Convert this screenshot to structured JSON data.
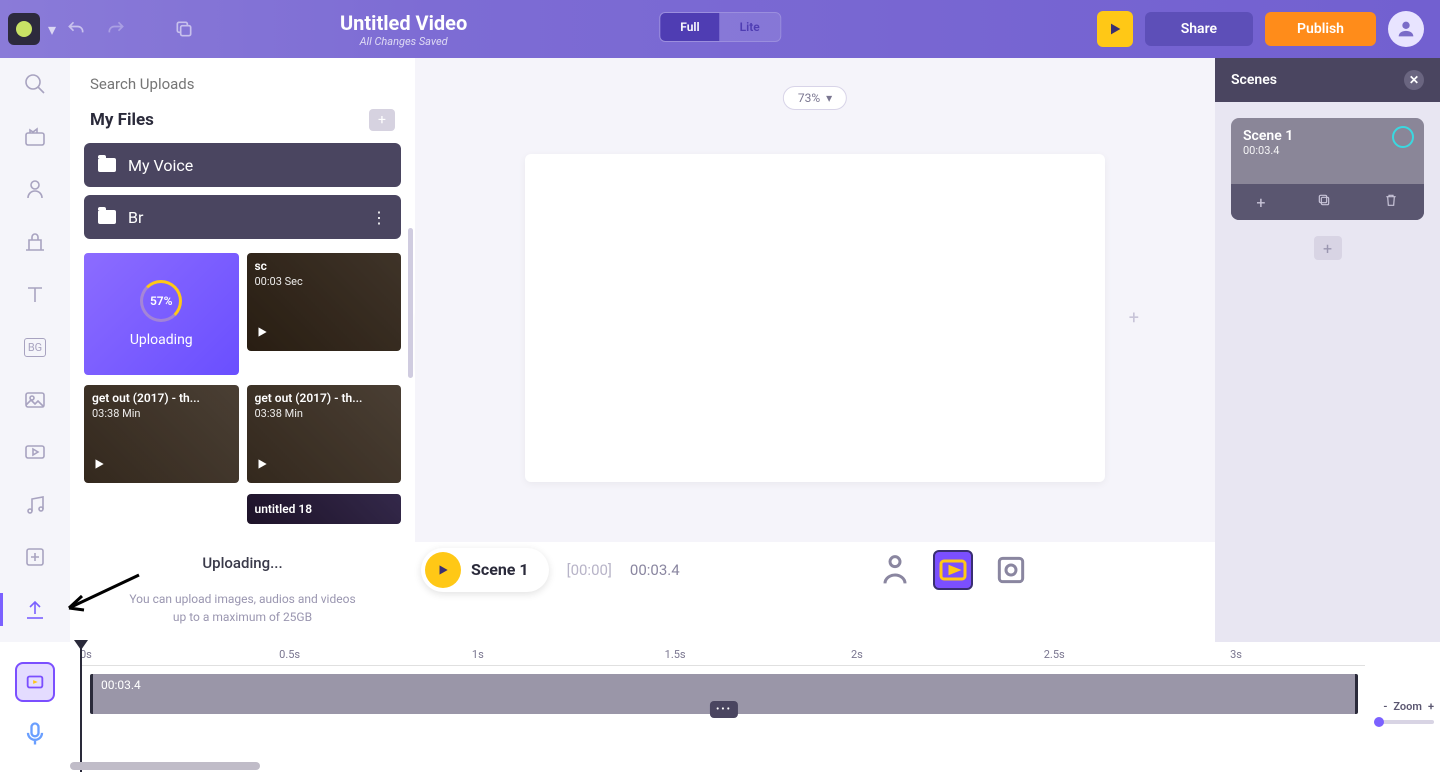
{
  "header": {
    "title": "Untitled Video",
    "save_status": "All Changes Saved",
    "toggle": {
      "full": "Full",
      "lite": "Lite"
    },
    "share": "Share",
    "publish": "Publish"
  },
  "uploads_panel": {
    "search_placeholder": "Search Uploads",
    "heading": "My Files",
    "folders": [
      {
        "name": "My Voice"
      },
      {
        "name": "Br"
      }
    ],
    "uploading_tile": {
      "percent": "57%",
      "label": "Uploading"
    },
    "clips": [
      {
        "name": "sc",
        "duration": "00:03 Sec"
      },
      {
        "name": "get out (2017) - th...",
        "duration": "03:38 Min"
      },
      {
        "name": "get out (2017) - th...",
        "duration": "03:38 Min"
      },
      {
        "name": "untitled 18",
        "duration": ""
      }
    ],
    "footer_status": "Uploading...",
    "footer_hint_1": "You can upload images, audios and videos",
    "footer_hint_2": "up to a maximum of 25GB"
  },
  "canvas": {
    "zoom": "73%"
  },
  "timeline_bar": {
    "scene_name": "Scene 1",
    "current": "[00:00]",
    "total": "00:03.4"
  },
  "scenes": {
    "title": "Scenes",
    "cards": [
      {
        "name": "Scene 1",
        "time": "00:03.4"
      }
    ]
  },
  "timeline": {
    "ticks": [
      "0s",
      "0.5s",
      "1s",
      "1.5s",
      "2s",
      "2.5s",
      "3s"
    ],
    "clip_time": "00:03.4",
    "zoom_label": "Zoom"
  }
}
